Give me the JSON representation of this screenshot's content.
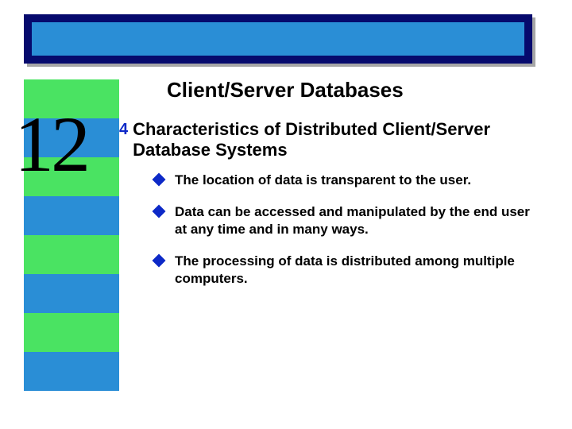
{
  "chapter_number": "12",
  "title": "Client/Server Databases",
  "heading_bullet_glyph": "4",
  "heading": "Characteristics of Distributed Client/Server Database Systems",
  "bullets": [
    "The location of data is transparent to the user.",
    "Data can be accessed and manipulated by the end user at any time and in many ways.",
    "The processing of data is distributed among multiple computers."
  ],
  "colors": {
    "navy": "#060a6d",
    "blue": "#2a8ed6",
    "green": "#4ae362",
    "bullet": "#0d29c7"
  }
}
